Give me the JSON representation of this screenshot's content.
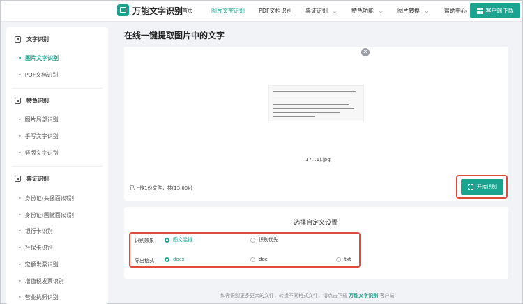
{
  "header": {
    "brand": "万能文字识别",
    "nav": [
      {
        "label": "首页",
        "caret": false
      },
      {
        "label": "图片文字识别",
        "caret": false,
        "active": true
      },
      {
        "label": "PDF文档识别",
        "caret": false
      },
      {
        "label": "票证识别",
        "caret": true
      },
      {
        "label": "特色功能",
        "caret": true
      },
      {
        "label": "图片转换",
        "caret": true
      },
      {
        "label": "帮助中心",
        "caret": false
      }
    ],
    "download_label": "客户端下载"
  },
  "sidebar": {
    "sections": [
      {
        "title": "文字识别",
        "items": [
          "图片文字识别",
          "PDF文档识别"
        ]
      },
      {
        "title": "特色识别",
        "items": [
          "图片局部识别",
          "手写文字识别",
          "竖版文字识别"
        ]
      },
      {
        "title": "票证识别",
        "items": [
          "身份证(头像面)识别",
          "身份证(国徽面)识别",
          "银行卡识别",
          "社保卡识别",
          "定额发票识别",
          "增值税发票识别",
          "营业执照识别"
        ]
      }
    ],
    "active_item": "图片文字识别"
  },
  "main": {
    "title": "在线一键提取图片中的文字",
    "file_name": "17...1).jpg",
    "upload_status": "已上传1份文件，共(13.00k)",
    "start_label": "开始识别",
    "close_icon": "close-icon"
  },
  "settings": {
    "title": "选择自定义设置",
    "rows": [
      {
        "label": "识别效果",
        "options": [
          {
            "label": "图文混排",
            "selected": true
          },
          {
            "label": "识别优先",
            "selected": false
          }
        ]
      },
      {
        "label": "导出格式",
        "options": [
          {
            "label": "docx",
            "selected": true
          },
          {
            "label": "doc",
            "selected": false
          },
          {
            "label": "txt",
            "selected": false
          }
        ]
      }
    ]
  },
  "footer": {
    "prefix": "如需识别更多更大的文件，转换不同格式文件，请点击下载",
    "link": "万能文字识别",
    "suffix": "客户端"
  },
  "colors": {
    "accent": "#1aa38e",
    "highlight": "#e04b3c",
    "page_bg": "#f1f3f6"
  }
}
